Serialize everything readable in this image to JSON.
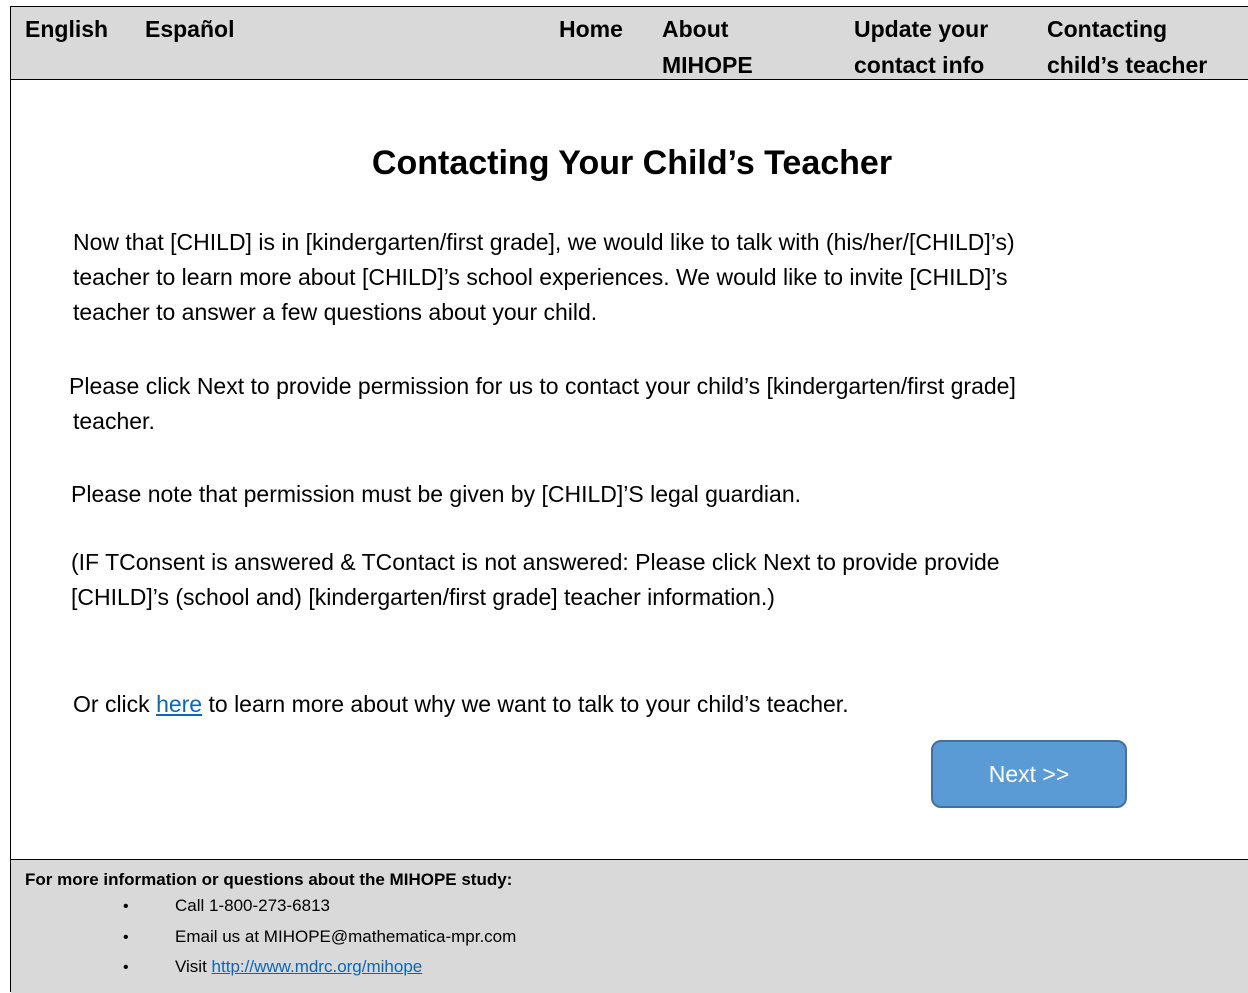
{
  "nav": {
    "english": "English",
    "espanol": "Español",
    "home": "Home",
    "about_line1": "About",
    "about_line2": "MIHOPE",
    "update_line1": "Update your",
    "update_line2": "contact info",
    "contacting_line1": "Contacting",
    "contacting_line2": "child’s teacher"
  },
  "main": {
    "title": "Contacting Your Child’s Teacher",
    "p1_line1": "Now that [CHILD] is in [kindergarten/first grade], we would like to talk with (his/her/[CHILD]’s)",
    "p1_line2": "teacher to learn more about [CHILD]’s school experiences. We would like to invite [CHILD]’s",
    "p1_line3": "teacher to answer a few questions about your child.",
    "p2_line1": "Please click Next to provide permission for us to contact your child’s [kindergarten/first grade]",
    "p2_line2": "teacher.",
    "p3": "Please note that permission must be given by [CHILD]’S legal guardian.",
    "p4_line1": "(IF TConsent is answered & TContact is not answered: Please click Next to provide provide",
    "p4_line2": "[CHILD]’s (school and) [kindergarten/first grade] teacher information.)",
    "p5_prefix": "Or click ",
    "p5_link": "here",
    "p5_suffix": " to learn more about why we want to talk to your child’s teacher.",
    "next_button": "Next >>"
  },
  "footer": {
    "heading": "For more information or questions about the MIHOPE study:",
    "bullet": "•",
    "call": "Call 1-800-273-6813",
    "email": "Email us at MIHOPE@mathematica-mpr.com",
    "visit_prefix": "Visit ",
    "visit_link": "http://www.mdrc.org/mihope"
  },
  "colors": {
    "nav_background": "#d9d9d9",
    "footer_background": "#d9d9d9",
    "button_fill": "#5b9bd5",
    "button_border": "#41719c",
    "link": "#0b67b6"
  }
}
